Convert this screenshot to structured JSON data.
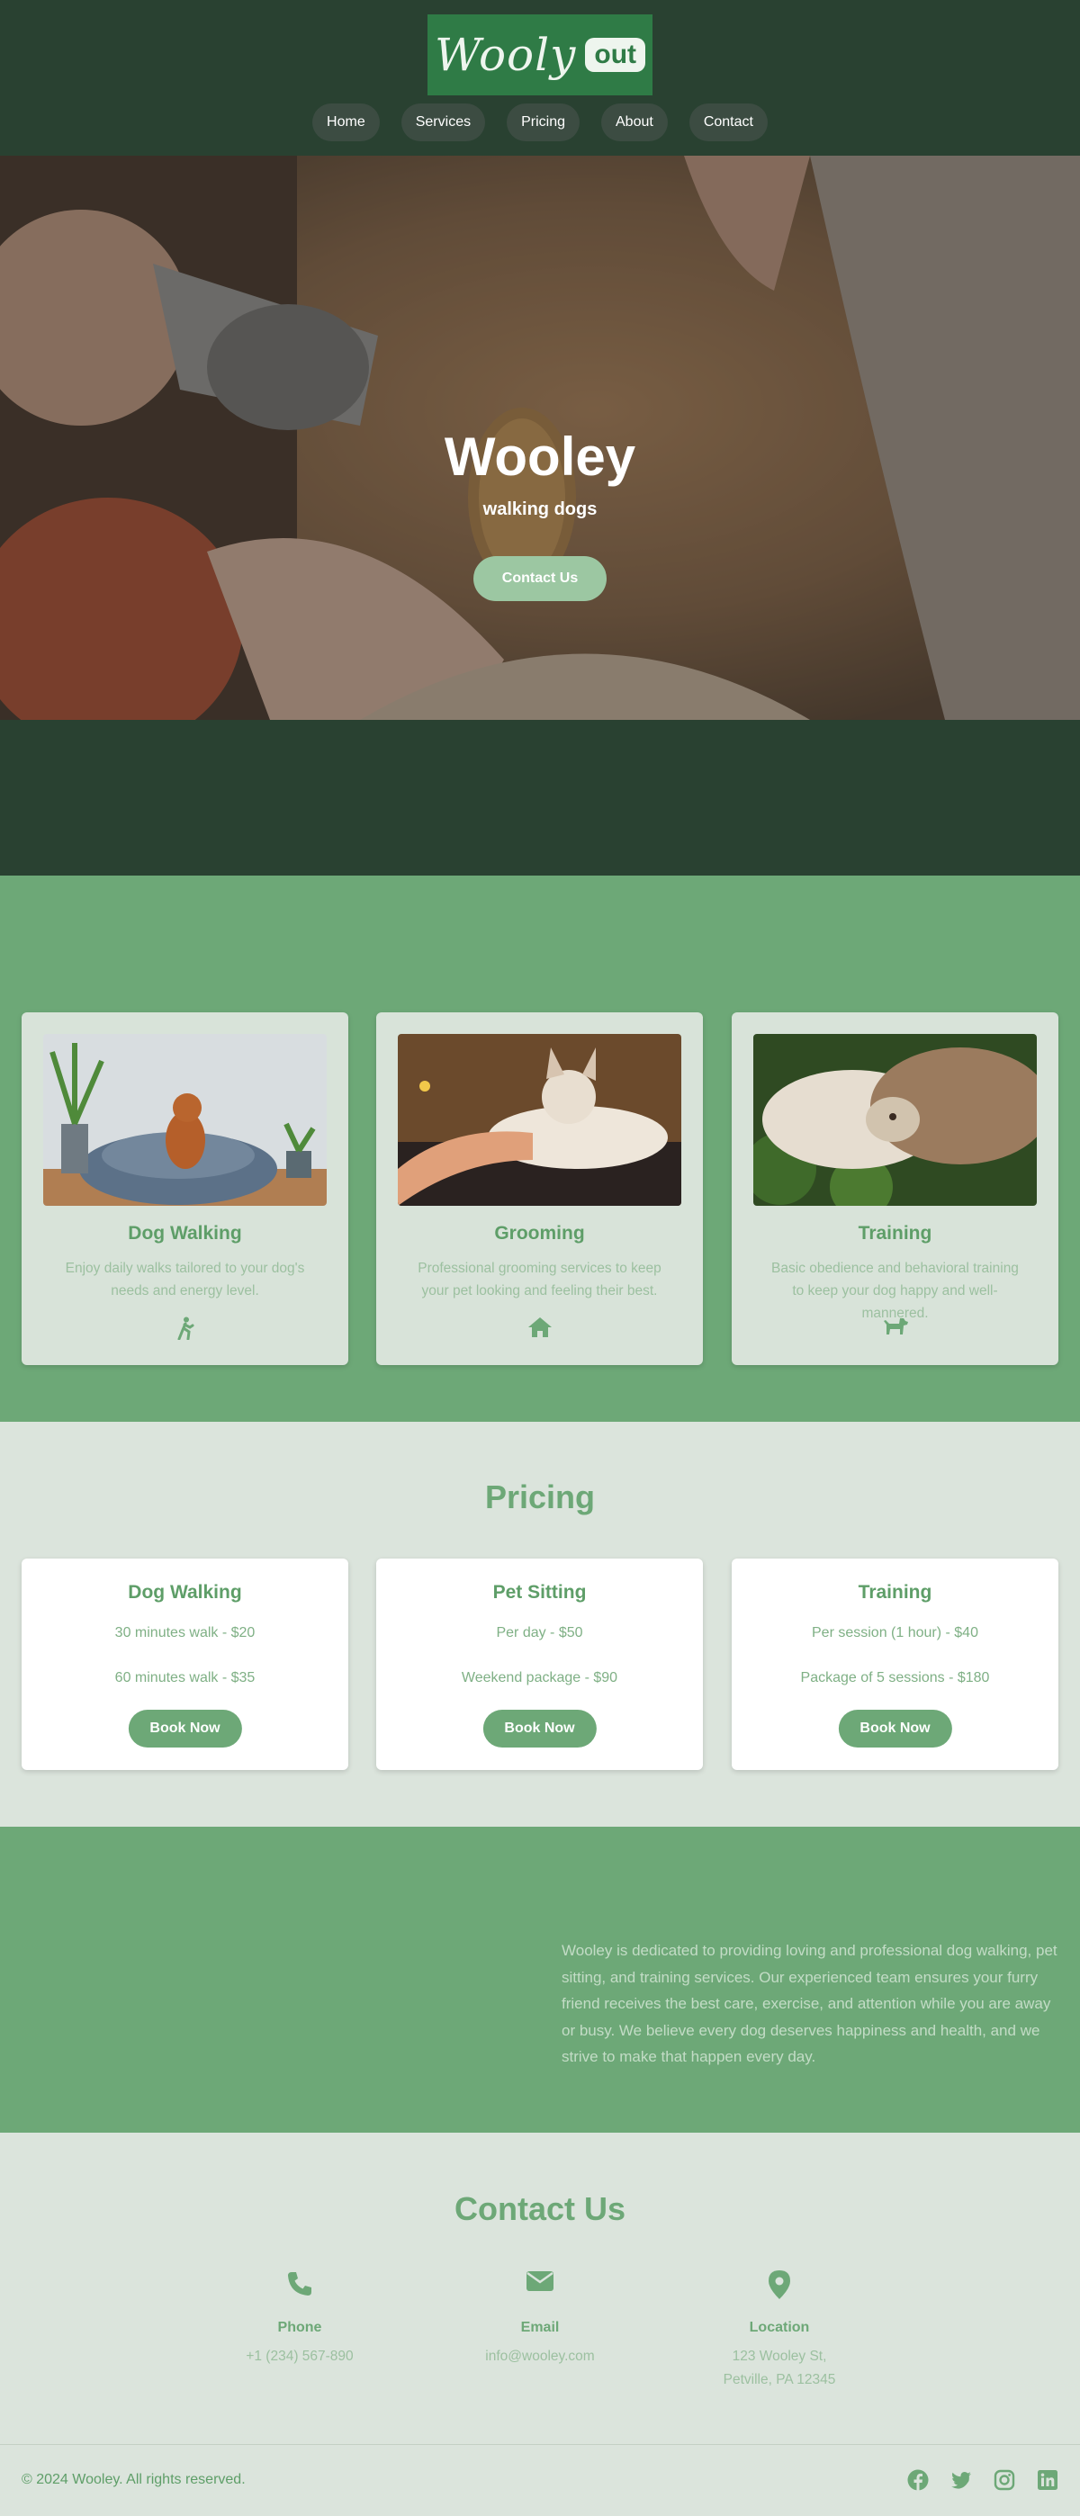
{
  "brand": {
    "logo_word": "Wooly",
    "logo_badge": "out"
  },
  "nav": {
    "items": [
      "Home",
      "Services",
      "Pricing",
      "About",
      "Contact"
    ]
  },
  "hero": {
    "title": "Wooley",
    "subtitle": "walking dogs",
    "button": "Contact Us"
  },
  "services": [
    {
      "title": "Dog Walking",
      "desc": "Enjoy daily walks tailored to your dog's needs and energy level.",
      "icon": "walking-person-icon"
    },
    {
      "title": "Grooming",
      "desc": "Professional grooming services to keep your pet looking and feeling their best.",
      "icon": "home-icon"
    },
    {
      "title": "Training",
      "desc": "Basic obedience and behavioral training to keep your dog happy and well-mannered.",
      "icon": "dog-icon"
    }
  ],
  "pricing": {
    "title": "Pricing",
    "cards": [
      {
        "title": "Dog Walking",
        "line1": "30 minutes walk - $20",
        "line2": "60 minutes walk - $35",
        "button": "Book Now"
      },
      {
        "title": "Pet Sitting",
        "line1": "Per day - $50",
        "line2": "Weekend package - $90",
        "button": "Book Now"
      },
      {
        "title": "Training",
        "line1": "Per session (1 hour) - $40",
        "line2": "Package of 5 sessions - $180",
        "button": "Book Now"
      }
    ]
  },
  "about": {
    "text": "Wooley is dedicated to providing loving and professional dog walking, pet sitting, and training services. Our experienced team ensures your furry friend receives the best care, exercise, and attention while you are away or busy. We believe every dog deserves happiness and health, and we strive to make that happen every day."
  },
  "contact": {
    "title": "Contact Us",
    "items": [
      {
        "label": "Phone",
        "value": "+1 (234) 567-890",
        "value2": "",
        "icon": "phone-icon"
      },
      {
        "label": "Email",
        "value": "info@wooley.com",
        "value2": "",
        "icon": "envelope-icon"
      },
      {
        "label": "Location",
        "value": "123 Wooley St,",
        "value2": "Petville, PA 12345",
        "icon": "map-pin-icon"
      }
    ]
  },
  "footer": {
    "copyright": "© 2024 Wooley. All rights reserved.",
    "socials": [
      "facebook-icon",
      "twitter-icon",
      "instagram-icon",
      "linkedin-icon"
    ]
  },
  "colors": {
    "dark_green": "#294131",
    "mid_green": "#6da877",
    "light_bg": "#dbe4dc",
    "accent_text": "#5e9e68"
  }
}
